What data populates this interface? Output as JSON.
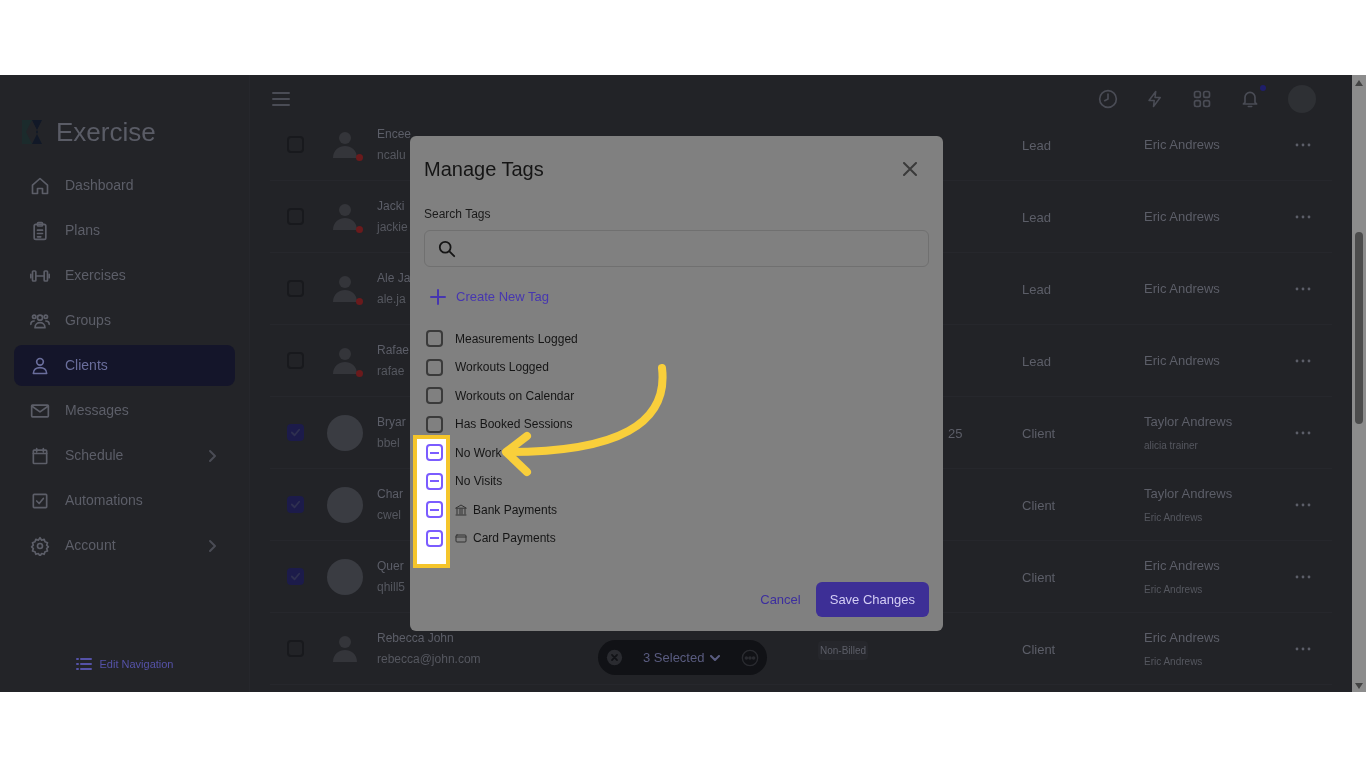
{
  "app": {
    "logo": "Exercise"
  },
  "sidebar": {
    "items": [
      {
        "label": "Dashboard",
        "selected": false,
        "expandable": false
      },
      {
        "label": "Plans",
        "selected": false,
        "expandable": false
      },
      {
        "label": "Exercises",
        "selected": false,
        "expandable": false
      },
      {
        "label": "Groups",
        "selected": false,
        "expandable": false
      },
      {
        "label": "Clients",
        "selected": true,
        "expandable": false
      },
      {
        "label": "Messages",
        "selected": false,
        "expandable": false
      },
      {
        "label": "Schedule",
        "selected": false,
        "expandable": true
      },
      {
        "label": "Automations",
        "selected": false,
        "expandable": false
      },
      {
        "label": "Account",
        "selected": false,
        "expandable": true
      }
    ],
    "edit_navigation": "Edit Navigation"
  },
  "header": {
    "notification_unread": true
  },
  "table": {
    "rows": [
      {
        "selected": false,
        "photo": false,
        "online_dot": true,
        "name": "Encee",
        "email": "ncalu",
        "type": "Lead",
        "coach": "Eric Andrews"
      },
      {
        "selected": false,
        "photo": false,
        "online_dot": true,
        "name": "Jacki",
        "email": "jackie",
        "type": "Lead",
        "coach": "Eric Andrews"
      },
      {
        "selected": false,
        "photo": false,
        "online_dot": true,
        "name": "Ale Ja",
        "email": "ale.ja",
        "type": "Lead",
        "coach": "Eric Andrews"
      },
      {
        "selected": false,
        "photo": false,
        "online_dot": true,
        "name": "Rafae",
        "email": "rafae",
        "type": "Lead",
        "coach": "Eric Andrews"
      },
      {
        "selected": true,
        "photo": true,
        "online_dot": false,
        "name": "Bryar",
        "email": "bbel",
        "column_3": "25",
        "type": "Client",
        "coach": "Taylor Andrews",
        "coach_sub": "alicia trainer"
      },
      {
        "selected": true,
        "photo": true,
        "online_dot": false,
        "name": "Char",
        "email": "cwel",
        "type": "Client",
        "coach": "Taylor Andrews",
        "coach_sub": "Eric Andrews"
      },
      {
        "selected": true,
        "photo": true,
        "online_dot": false,
        "name": "Quer",
        "email": "qhill5",
        "type": "Client",
        "coach": "Eric Andrews",
        "coach_sub": "Eric Andrews"
      },
      {
        "selected": false,
        "photo": false,
        "online_dot": false,
        "name": "Rebecca John",
        "email": "rebecca@john.com",
        "billing": "Non-Billed",
        "type": "Client",
        "coach": "Eric Andrews",
        "coach_sub": "Eric Andrews"
      }
    ]
  },
  "selection_bar": {
    "label": "3 Selected"
  },
  "modal": {
    "title": "Manage Tags",
    "search_label": "Search Tags",
    "create_tag": "Create New Tag",
    "tags": [
      {
        "label": "Measurements Logged",
        "kind": "plain",
        "indeterminate": false
      },
      {
        "label": "Workouts Logged",
        "kind": "plain",
        "indeterminate": false
      },
      {
        "label": "Workouts on Calendar",
        "kind": "plain",
        "indeterminate": false
      },
      {
        "label": "Has Booked Sessions",
        "kind": "plain",
        "indeterminate": false
      },
      {
        "label": "No Work",
        "kind": "plain",
        "indeterminate": true
      },
      {
        "label": "No Visits",
        "kind": "plain",
        "indeterminate": true
      },
      {
        "label": "Bank Payments",
        "kind": "bank",
        "indeterminate": true
      },
      {
        "label": "Card Payments",
        "kind": "card",
        "indeterminate": true
      }
    ],
    "cancel": "Cancel",
    "save": "Save Changes"
  }
}
